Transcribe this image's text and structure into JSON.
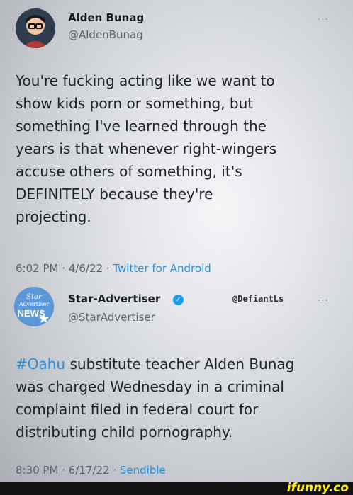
{
  "tweets": [
    {
      "author_name": "Alden Bunag",
      "author_handle": "@AldenBunag",
      "more_icon": "more-horizontal-icon",
      "text": "You're fucking acting like we want to\nshow kids porn or something, but\nsomething I've learned through the\nyears is that whenever right-wingers\naccuse others of something, it's\nDEFINITELY because they're\nprojecting.",
      "time": "6:02 PM · 4/6/22 · ",
      "source": "Twitter for Android"
    },
    {
      "author_name": "Star-Advertiser",
      "author_handle": "@StarAdvertiser",
      "verified": true,
      "overlay_tag": "@DefiantLs",
      "avatar_text_1": "Star",
      "avatar_text_2": "Advertiser",
      "avatar_text_3": "NEWS",
      "hashtag": "#Oahu",
      "text_rest": " substitute teacher Alden Bunag\nwas charged Wednesday in a criminal\ncomplaint filed in federal court for\ndistributing child pornography.",
      "time": "8:30 PM · 6/17/22 · ",
      "source": "Sendible"
    }
  ],
  "watermark": "ifunny.co",
  "colors": {
    "link": "#2a8fd8",
    "verified": "#1d9bf0",
    "watermark": "#fff200"
  }
}
